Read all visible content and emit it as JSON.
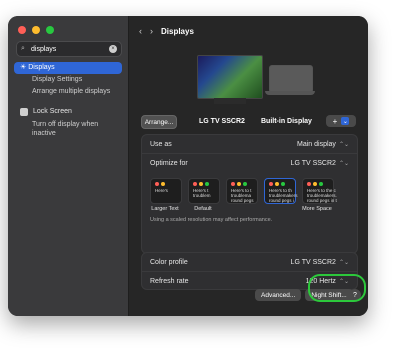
{
  "window": {
    "title": "Displays"
  },
  "sidebar": {
    "search_value": "displays",
    "items": [
      {
        "label": "Displays",
        "active": true
      },
      {
        "label": "Display Settings",
        "active": false
      },
      {
        "label": "Arrange multiple displays",
        "active": false
      },
      {
        "label": "Lock Screen",
        "active": false
      },
      {
        "label": "Turn off display when inactive",
        "active": false
      }
    ]
  },
  "displays": {
    "arrange_label": "Arrange...",
    "display1_name": "LG TV SSCR2",
    "display2_name": "Built-in Display",
    "add_label": "+",
    "add_chevron": "⌄"
  },
  "settings": {
    "use_as": {
      "label": "Use as",
      "value": "Main display"
    },
    "optimize_for": {
      "label": "Optimize for",
      "value": "LG TV SSCR2"
    },
    "resolutions": [
      {
        "name": "Larger Text",
        "preview": "Here's"
      },
      {
        "name": "Default",
        "preview": "Here's t\ntroublem"
      },
      {
        "name": "",
        "preview": "Here's to t\ntroublema\nround pegs"
      },
      {
        "name": "",
        "preview": "Here's to th\ntroublemakers\nround pegs i"
      },
      {
        "name": "More Space",
        "preview": "Here's to the c\ntroublemakers.\nround pegs in t"
      }
    ],
    "note": "Using a scaled resolution may affect performance.",
    "color_profile": {
      "label": "Color profile",
      "value": "LG TV SSCR2"
    },
    "refresh_rate": {
      "label": "Refresh rate",
      "value": "120 Hertz"
    }
  },
  "footer": {
    "advanced_label": "Advanced...",
    "nightshift_label": "Night Shift...",
    "help_label": "?"
  },
  "colors": {
    "accent": "#2f66d6",
    "highlight": "#2cc83b"
  }
}
